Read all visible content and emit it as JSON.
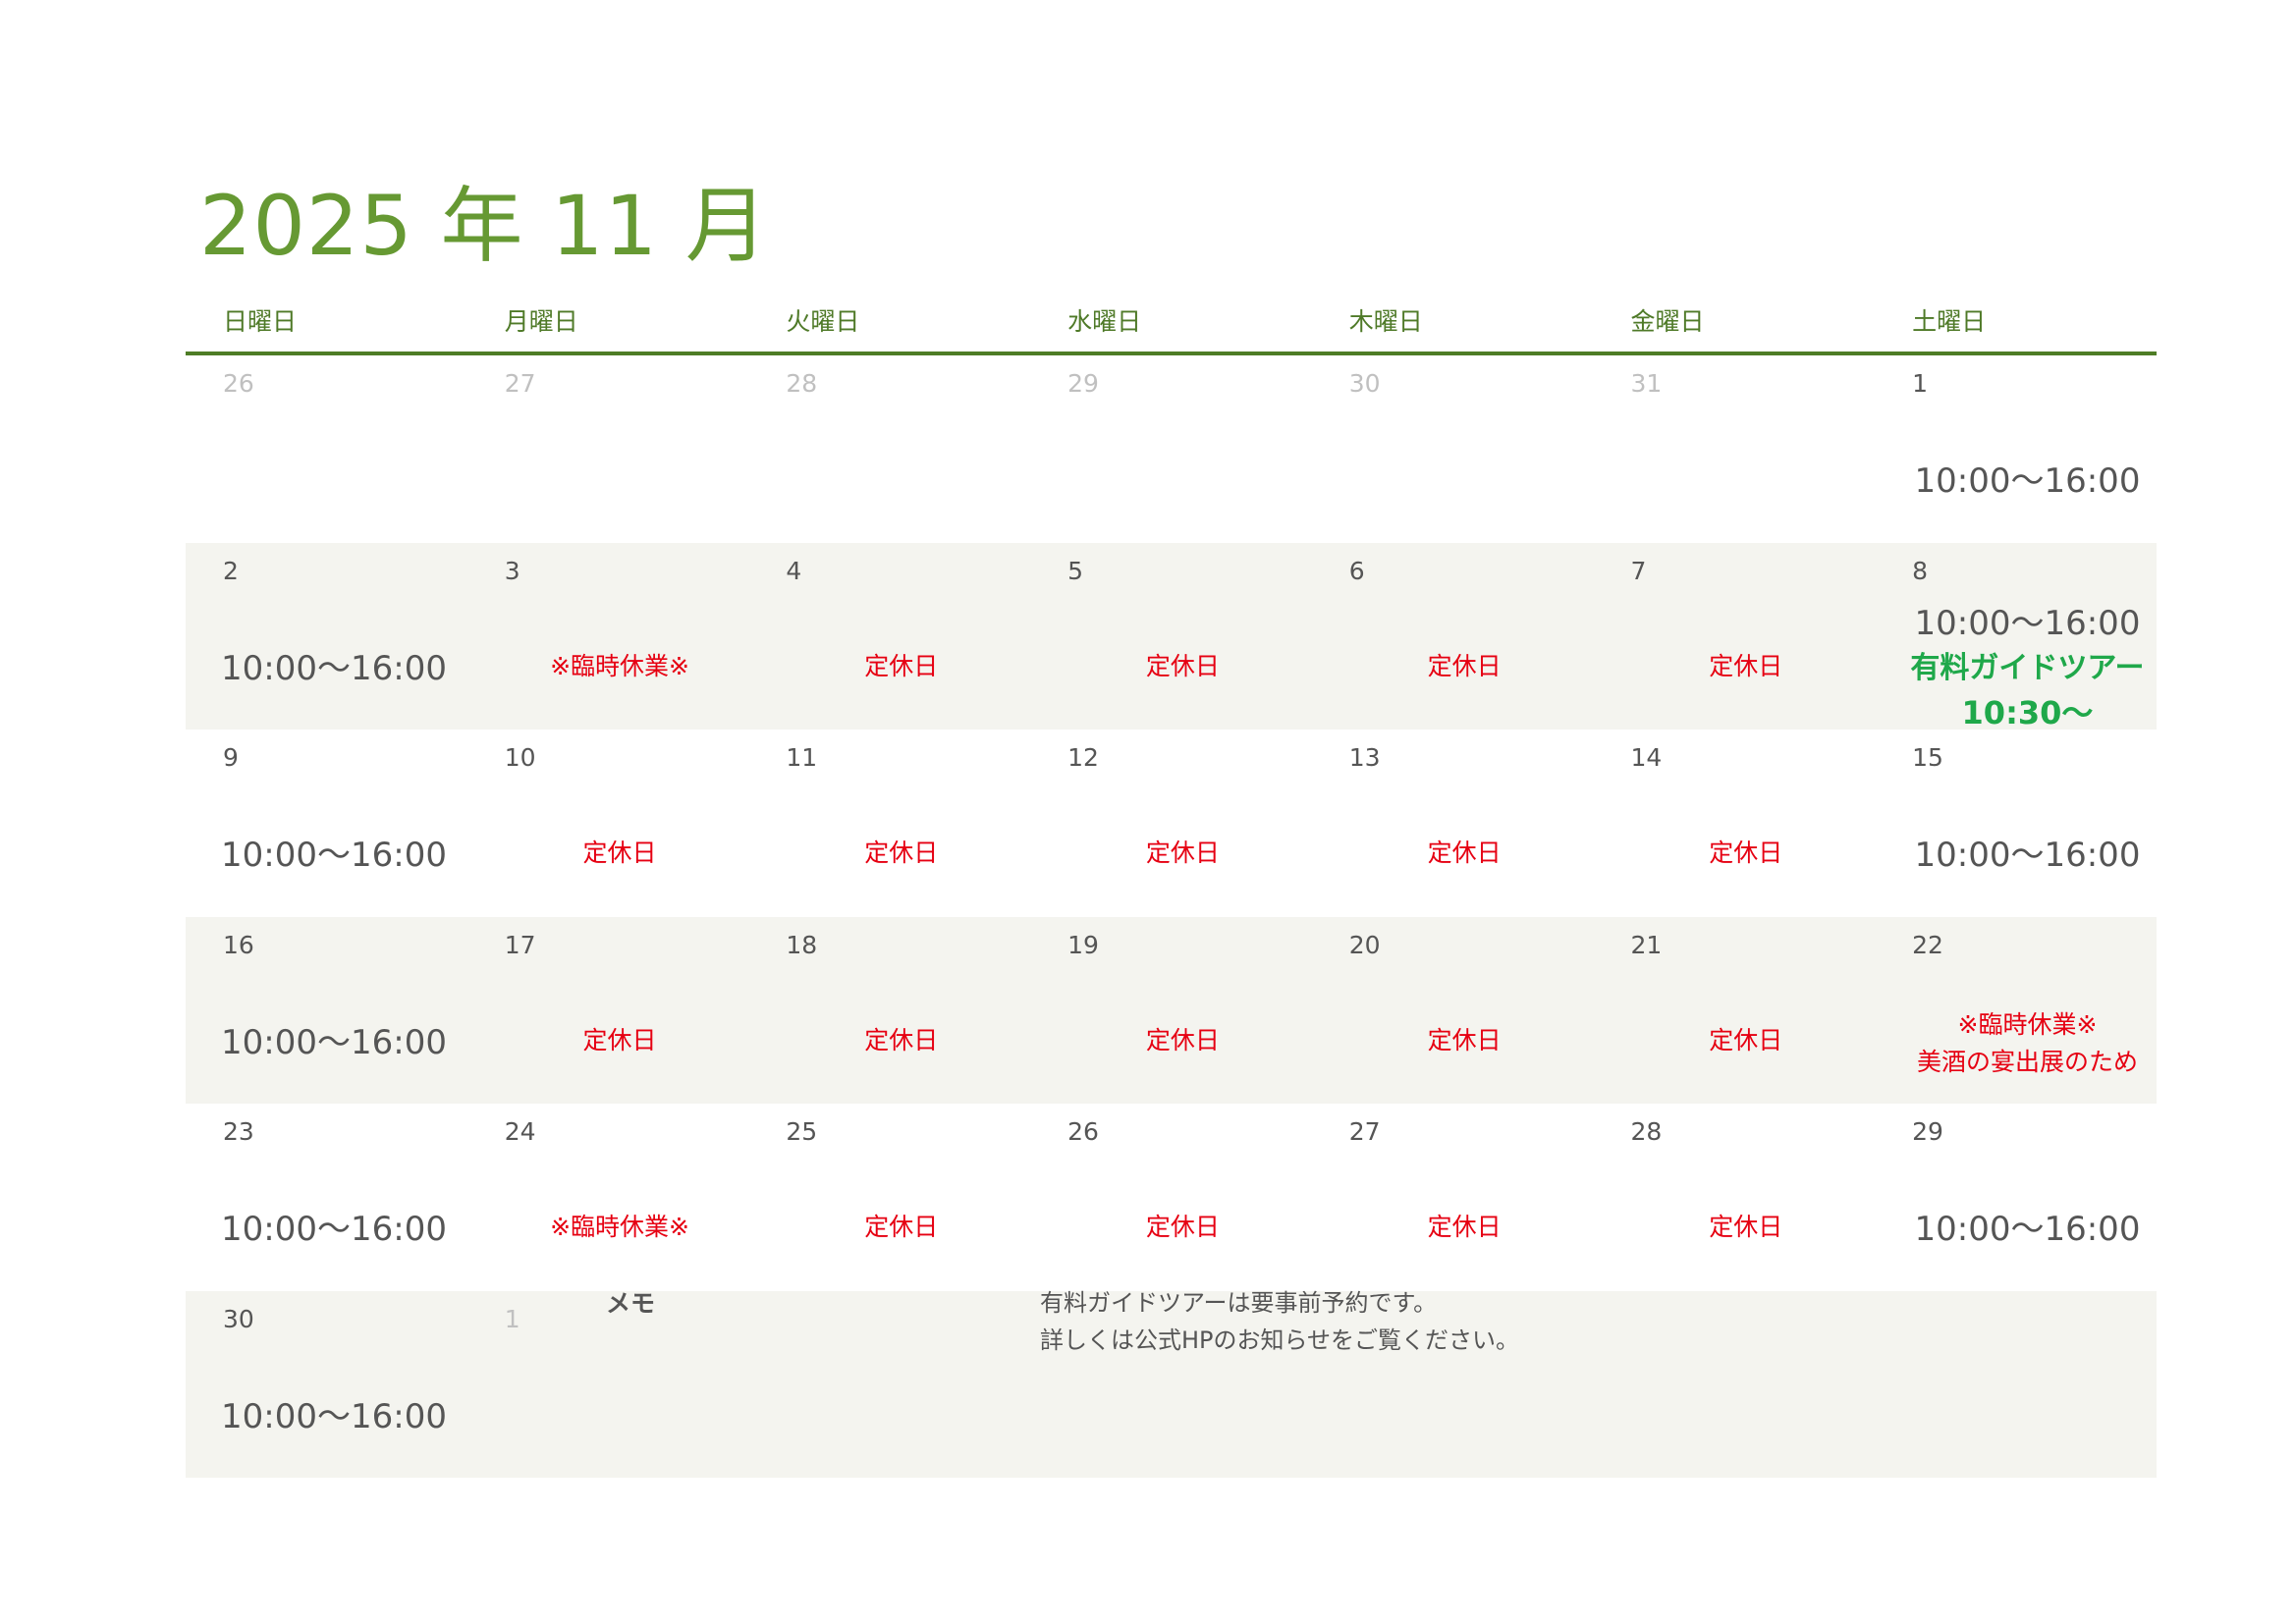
{
  "title": "2025 年 11 月",
  "weekdays": [
    "日曜日",
    "月曜日",
    "火曜日",
    "水曜日",
    "木曜日",
    "金曜日",
    "土曜日"
  ],
  "hours_text": "10:00〜16:00",
  "closed_text": "定休日",
  "temp_closed_text": "※臨時休業※",
  "weeks": [
    {
      "days": [
        "26",
        "27",
        "28",
        "29",
        "30",
        "31",
        "1"
      ]
    },
    {
      "days": [
        "2",
        "3",
        "4",
        "5",
        "6",
        "7",
        "8"
      ]
    },
    {
      "days": [
        "9",
        "10",
        "11",
        "12",
        "13",
        "14",
        "15"
      ]
    },
    {
      "days": [
        "16",
        "17",
        "18",
        "19",
        "20",
        "21",
        "22"
      ]
    },
    {
      "days": [
        "23",
        "24",
        "25",
        "26",
        "27",
        "28",
        "29"
      ]
    },
    {
      "days": [
        "30",
        "1"
      ]
    }
  ],
  "special": {
    "day8_tour": "有料ガイドツアー",
    "day8_time": "10:30〜",
    "day22_line1": "※臨時休業※",
    "day22_line2": "美酒の宴出展のため"
  },
  "memo": {
    "label": "メモ",
    "line1": "有料ガイドツアーは要事前予約です。",
    "line2": "詳しくは公式HPのお知らせをご覧ください。"
  },
  "colors": {
    "title": "#669933",
    "closed": "#e60012",
    "tour": "#1fa84a",
    "shade": "#f4f4ef"
  }
}
